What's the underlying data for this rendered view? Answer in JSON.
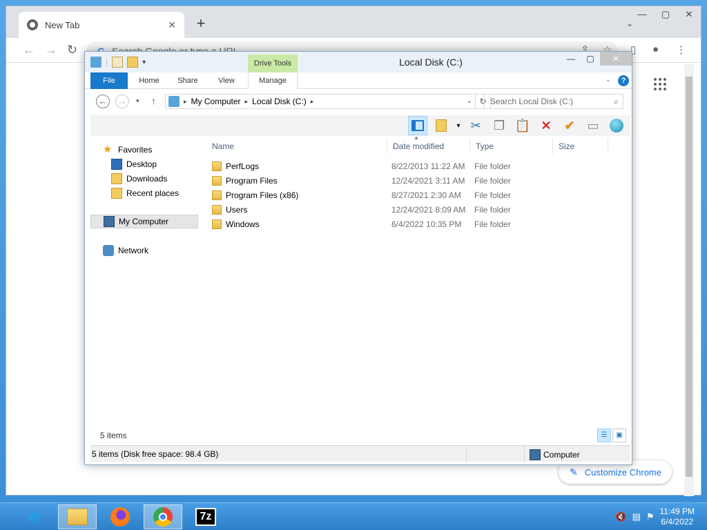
{
  "browser": {
    "tab_title": "New Tab",
    "tab_close": "✕",
    "new_tab": "+",
    "tab_search": "⌄",
    "window_controls": [
      "—",
      "▢",
      "✕"
    ],
    "omnibox_placeholder": "Search Google or type a URL",
    "omnibox_g": "G",
    "customize_label": "Customize Chrome"
  },
  "explorer": {
    "title": "Local Disk (C:)",
    "context_tab": "Drive Tools",
    "ribbon_tabs": [
      "File",
      "Home",
      "Share",
      "View",
      "Manage"
    ],
    "breadcrumbs": [
      "My Computer",
      "Local Disk (C:)"
    ],
    "search_placeholder": "Search Local Disk (C:)",
    "nav": {
      "favorites": "Favorites",
      "favorites_items": [
        "Desktop",
        "Downloads",
        "Recent places"
      ],
      "computer": "My Computer",
      "network": "Network"
    },
    "columns": [
      "Name",
      "Date modified",
      "Type",
      "Size"
    ],
    "files": [
      {
        "name": "PerfLogs",
        "date": "8/22/2013 11:22 AM",
        "type": "File folder"
      },
      {
        "name": "Program Files",
        "date": "12/24/2021 3:11 AM",
        "type": "File folder"
      },
      {
        "name": "Program Files (x86)",
        "date": "8/27/2021 2:30 AM",
        "type": "File folder"
      },
      {
        "name": "Users",
        "date": "12/24/2021 8:09 AM",
        "type": "File folder"
      },
      {
        "name": "Windows",
        "date": "6/4/2022 10:35 PM",
        "type": "File folder"
      }
    ],
    "item_count": "5 items",
    "status_left": "5 items (Disk free space: 98.4 GB)",
    "status_right": "Computer"
  },
  "taskbar": {
    "items": [
      "internet-explorer",
      "file-explorer",
      "firefox",
      "chrome",
      "7-zip"
    ],
    "sevenzip_label": "7z",
    "time": "11:49 PM",
    "date": "6/4/2022"
  }
}
